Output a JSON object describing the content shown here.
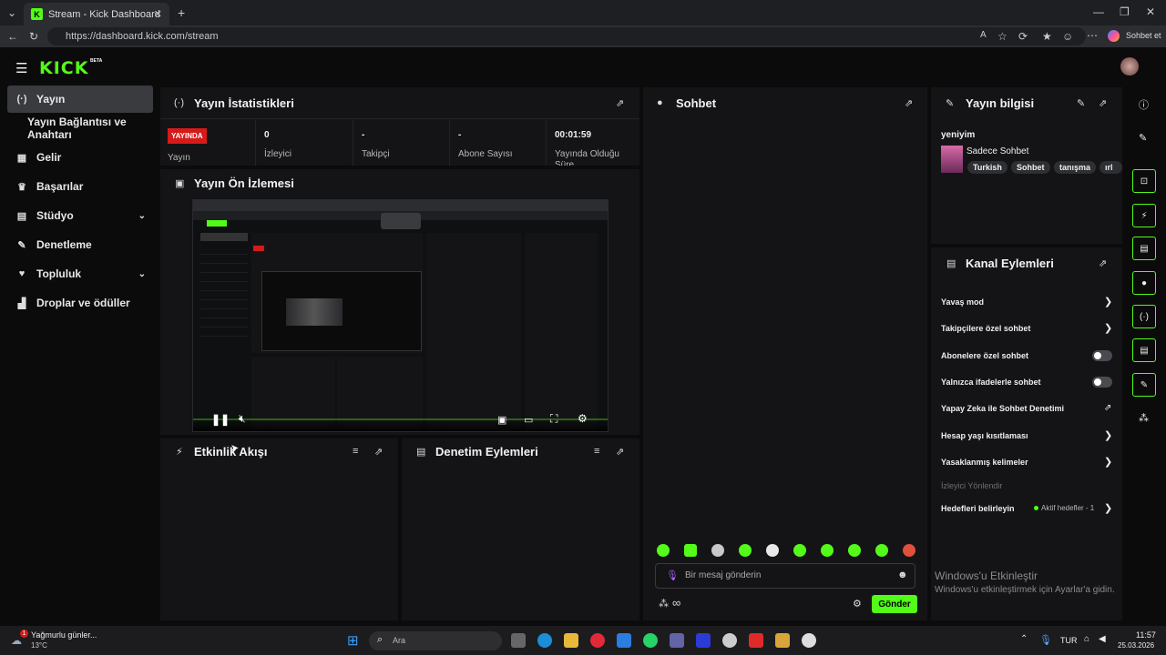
{
  "browser": {
    "tab_title": "Stream - Kick Dashboard",
    "url": "https://dashboard.kick.com/stream",
    "copilot_label": "Sohbet et"
  },
  "app": {
    "logo": "KICK",
    "beta": "BETA"
  },
  "sidebar": {
    "items": [
      {
        "label": "Yayın",
        "icon": "broadcast-icon"
      },
      {
        "label": "Yayın Bağlantısı ve Anahtarı",
        "icon": ""
      },
      {
        "label": "Gelir",
        "icon": "revenue-icon"
      },
      {
        "label": "Başarılar",
        "icon": "trophy-icon"
      },
      {
        "label": "Stüdyo",
        "icon": "studio-icon"
      },
      {
        "label": "Denetleme",
        "icon": "wrench-icon"
      },
      {
        "label": "Topluluk",
        "icon": "community-icon"
      },
      {
        "label": "Droplar ve ödüller",
        "icon": "gift-icon"
      }
    ]
  },
  "stats": {
    "title": "Yayın İstatistikleri",
    "live_badge": "YAYINDA",
    "cells": [
      {
        "label": "Yayın",
        "value": ""
      },
      {
        "label": "İzleyici",
        "value": "0"
      },
      {
        "label": "Takipçi",
        "value": "-"
      },
      {
        "label": "Abone Sayısı",
        "value": "-"
      },
      {
        "label": "Yayında Olduğu Süre",
        "value": "00:01:59"
      }
    ]
  },
  "preview": {
    "title": "Yayın Ön İzlemesi"
  },
  "activity": {
    "title": "Etkinlik Akışı"
  },
  "moderation": {
    "title": "Denetim Eylemleri"
  },
  "chat": {
    "title": "Sohbet",
    "placeholder": "Bir mesaj gönderin",
    "send_label": "Gönder",
    "infinity": "∞"
  },
  "stream_info": {
    "title": "Yayın bilgisi",
    "stream_title": "yeniyim",
    "category": "Sadece Sohbet",
    "tags": [
      "Turkish",
      "Sohbet",
      "tanışma",
      "ırl"
    ]
  },
  "channel_actions": {
    "title": "Kanal Eylemleri",
    "items": [
      {
        "label": "Yavaş mod",
        "control": "chevron"
      },
      {
        "label": "Takipçilere özel sohbet",
        "control": "chevron"
      },
      {
        "label": "Abonelere özel sohbet",
        "control": "toggle"
      },
      {
        "label": "Yalnızca ifadelerle sohbet",
        "control": "toggle"
      },
      {
        "label": "Yapay Zeka ile Sohbet Denetimi",
        "control": "external"
      },
      {
        "label": "Hesap yaşı kısıtlaması",
        "control": "chevron"
      },
      {
        "label": "Yasaklanmış kelimeler",
        "control": "chevron"
      }
    ],
    "section_label": "İzleyici Yönlendir",
    "goals_label": "Hedefleri belirleyin",
    "goals_status": "Aktif hedefler - 1"
  },
  "watermark": {
    "line1": "Windows'u Etkinleştir",
    "line2": "Windows'u etkinleştirmek için Ayarlar'a gidin."
  },
  "taskbar": {
    "weather": "Yağmurlu günler...",
    "temp": "13°C",
    "search": "Ara",
    "lang": "TUR",
    "time": "11:57",
    "date": "25.03.2026",
    "weather_badge": "1"
  },
  "colors": {
    "accent": "#53fc18",
    "live": "#d61a1a",
    "panel": "#141416"
  }
}
